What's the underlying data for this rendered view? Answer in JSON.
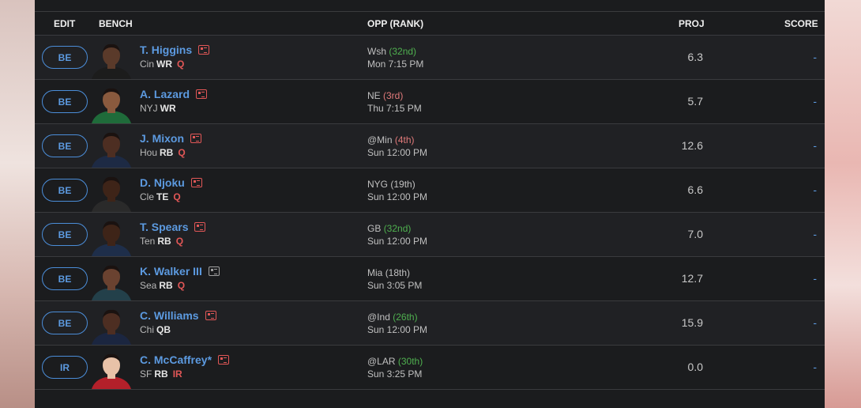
{
  "header": {
    "edit": "EDIT",
    "bench": "BENCH",
    "opp": "OPP (RANK)",
    "proj": "PROJ",
    "score": "SCORE"
  },
  "colors": {
    "accent": "#5c9ae0",
    "status_red": "#e25757",
    "rank_green": "#4fb04f",
    "rank_red": "#e07a7a",
    "background": "#1b1c1e"
  },
  "players": [
    {
      "slot": "BE",
      "name": "T. Higgins",
      "news_icon": "news-red",
      "team": "Cin",
      "pos": "WR",
      "status": "Q",
      "opp": "Wsh",
      "rank": "32nd",
      "rank_color": "good",
      "time": "Mon 7:15 PM",
      "proj": "6.3",
      "score": "-",
      "jersey": "#1c1c1c",
      "skin": "#5a3a2a"
    },
    {
      "slot": "BE",
      "name": "A. Lazard",
      "news_icon": "news-red",
      "team": "NYJ",
      "pos": "WR",
      "status": "",
      "opp": "NE",
      "rank": "3rd",
      "rank_color": "bad",
      "time": "Thu 7:15 PM",
      "proj": "5.7",
      "score": "-",
      "jersey": "#1f6b3a",
      "skin": "#8a5a3e"
    },
    {
      "slot": "BE",
      "name": "J. Mixon",
      "news_icon": "news-red",
      "team": "Hou",
      "pos": "RB",
      "status": "Q",
      "opp": "@Min",
      "rank": "4th",
      "rank_color": "bad",
      "time": "Sun 12:00 PM",
      "proj": "12.6",
      "score": "-",
      "jersey": "#1d2a44",
      "skin": "#4d2e22"
    },
    {
      "slot": "BE",
      "name": "D. Njoku",
      "news_icon": "news-red",
      "team": "Cle",
      "pos": "TE",
      "status": "Q",
      "opp": "NYG",
      "rank": "19th",
      "rank_color": "mid",
      "time": "Sun 12:00 PM",
      "proj": "6.6",
      "score": "-",
      "jersey": "#2a2a2a",
      "skin": "#3e2418"
    },
    {
      "slot": "BE",
      "name": "T. Spears",
      "news_icon": "news-red",
      "team": "Ten",
      "pos": "RB",
      "status": "Q",
      "opp": "GB",
      "rank": "32nd",
      "rank_color": "good",
      "time": "Sun 12:00 PM",
      "proj": "7.0",
      "score": "-",
      "jersey": "#1e2e4a",
      "skin": "#3e2418"
    },
    {
      "slot": "BE",
      "name": "K. Walker III",
      "news_icon": "news-gray",
      "team": "Sea",
      "pos": "RB",
      "status": "Q",
      "opp": "Mia",
      "rank": "18th",
      "rank_color": "mid",
      "time": "Sun 3:05 PM",
      "proj": "12.7",
      "score": "-",
      "jersey": "#23404a",
      "skin": "#6a4230"
    },
    {
      "slot": "BE",
      "name": "C. Williams",
      "news_icon": "news-red",
      "team": "Chi",
      "pos": "QB",
      "status": "",
      "opp": "@Ind",
      "rank": "26th",
      "rank_color": "good",
      "time": "Sun 12:00 PM",
      "proj": "15.9",
      "score": "-",
      "jersey": "#1b2640",
      "skin": "#4d2e22"
    },
    {
      "slot": "IR",
      "name": "C. McCaffrey*",
      "news_icon": "news-red",
      "team": "SF",
      "pos": "RB",
      "status": "IR",
      "opp": "@LAR",
      "rank": "30th",
      "rank_color": "good",
      "time": "Sun 3:25 PM",
      "proj": "0.0",
      "score": "-",
      "jersey": "#b3202a",
      "skin": "#e8c2a8"
    }
  ]
}
